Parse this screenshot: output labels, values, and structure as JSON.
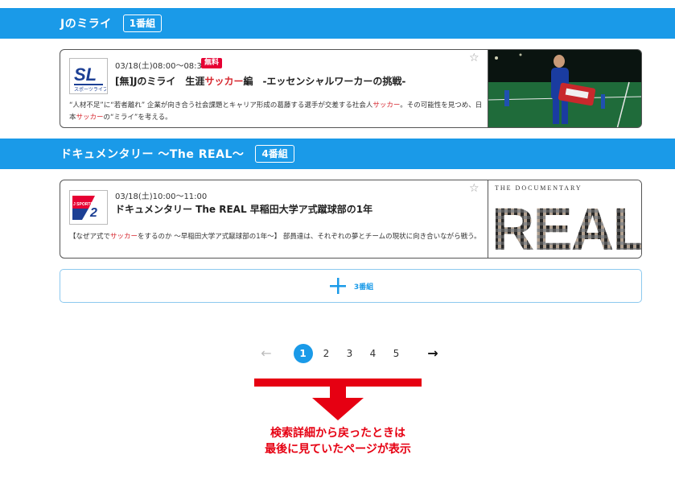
{
  "sections": [
    {
      "title": "Jのミライ",
      "count": "1番組"
    },
    {
      "title": "ドキュメンタリー ～The REAL～",
      "count": "4番組"
    }
  ],
  "programs": [
    {
      "channel_logo_text": "SL",
      "channel_logo_sub": "スポーツライブ+",
      "datetime": "03/18(土)08:00～08:30",
      "badge": "無料",
      "title_pre": "[無]Jのミライ　生涯",
      "title_hl": "サッカー",
      "title_post": "編　-エッセンシャルワーカーの挑戦-",
      "desc_line1_pre": "“人材不足”に“若者離れ” 企業が向き合う社会課題とキャリア形成の葛藤する選手が交差する社会人",
      "desc_line1_hl": "サッカー",
      "desc_line1_post": "。その可能性を見つめ、日",
      "desc_line2_pre": "本",
      "desc_line2_hl": "サッカー",
      "desc_line2_post": "の“ミライ”を考える。"
    },
    {
      "channel_logo_text": "J SPORTS 2",
      "datetime": "03/18(土)10:00～11:00",
      "title": "ドキュメンタリー The REAL 早稲田大学ア式蹴球部の1年",
      "desc_pre": "【なぜア式で",
      "desc_hl": "サッカー",
      "desc_post": "をするのか ～早稲田大学ア式蹴球部の1年～】 部員達は、それぞれの夢とチームの現状に向き合いながら戦う。",
      "thumb_title_small": "THE DOCUMENTARY",
      "thumb_title_big": "REAL"
    }
  ],
  "add_button": {
    "label": "3番組"
  },
  "pagination": {
    "prev": "←",
    "pages": [
      "1",
      "2",
      "3",
      "4",
      "5"
    ],
    "current": "1",
    "next": "→"
  },
  "annotation": {
    "line1": "検索詳細から戻ったときは",
    "line2": "最後に見ていたページが表示"
  },
  "colors": {
    "accent": "#1a9ae8",
    "badge": "#e60033",
    "highlight": "#d6262e",
    "annotation": "#e60012"
  }
}
